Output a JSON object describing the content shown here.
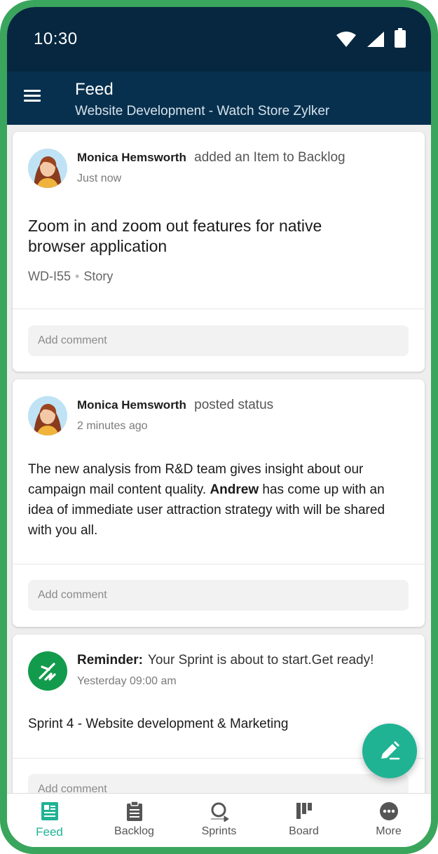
{
  "status_bar": {
    "time": "10:30"
  },
  "app_bar": {
    "title": "Feed",
    "subtitle": "Website Development - Watch Store Zylker"
  },
  "feed": [
    {
      "author": "Monica Hemsworth",
      "action": "added an Item to Backlog",
      "time": "Just now",
      "headline_line1": "Zoom in and zoom out features for native",
      "headline_line2": "browser application",
      "item_id": "WD-I55",
      "item_type": "Story",
      "comment_placeholder": "Add comment"
    },
    {
      "author": "Monica Hemsworth",
      "action": "posted status",
      "time": "2 minutes ago",
      "body_part1": "The new analysis from R&D team gives insight about our campaign mail content quality.",
      "body_mention": "Andrew",
      "body_part2": "has come up with an idea of immediate user attraction strategy with will be shared with you all.",
      "comment_placeholder": "Add comment"
    },
    {
      "label": "Reminder:",
      "message": "Your Sprint is about to start.Get ready!",
      "time": "Yesterday 09:00 am",
      "sprint": "Sprint 4 - Website development & Marketing",
      "comment_placeholder": "Add comment"
    }
  ],
  "bottom_nav": [
    {
      "label": "Feed",
      "icon": "feed-icon",
      "active": true
    },
    {
      "label": "Backlog",
      "icon": "clipboard-icon",
      "active": false
    },
    {
      "label": "Sprints",
      "icon": "sprint-loop-icon",
      "active": false
    },
    {
      "label": "Board",
      "icon": "board-icon",
      "active": false
    },
    {
      "label": "More",
      "icon": "more-dots-icon",
      "active": false
    }
  ],
  "colors": {
    "status_bar": "#06273f",
    "app_bar": "#07304e",
    "accent": "#1fb394",
    "reminder_icon_bg": "#129b4c",
    "device_frame": "#3aa55c"
  }
}
